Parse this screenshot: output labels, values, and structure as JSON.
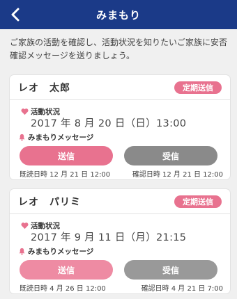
{
  "header": {
    "title": "みまもり"
  },
  "intro": "ご家族の活動を確認し、活動状況を知りたいご家族に安否確認メッセージを送りましょう。",
  "cards": [
    {
      "name": "レオ　太郎",
      "regular_label": "定期送信",
      "status_label": "活動状況",
      "status_time": "2017 年 8 月 20 日（日）13:00",
      "message_label": "みまもりメッセージ",
      "send_label": "送信",
      "receive_label": "受信",
      "read_info": "既読日時 12 月 21 日 12:00",
      "confirm_info": "確認日時 12 月 21 日 12:00"
    },
    {
      "name": "レオ　パリミ",
      "regular_label": "定期送信",
      "status_label": "活動状況",
      "status_time": "2017 年 9 月 11 日（月）21:15",
      "message_label": "みまもりメッセージ",
      "send_label": "送信",
      "receive_label": "受信",
      "read_info": "既読日時 4 月 26 日 12:00",
      "confirm_info": "確認日時 4 月 21 日 7:00"
    }
  ],
  "colors": {
    "header": "#1b3a88",
    "accent": "#e8728f",
    "disabled": "#8a8a8a"
  }
}
